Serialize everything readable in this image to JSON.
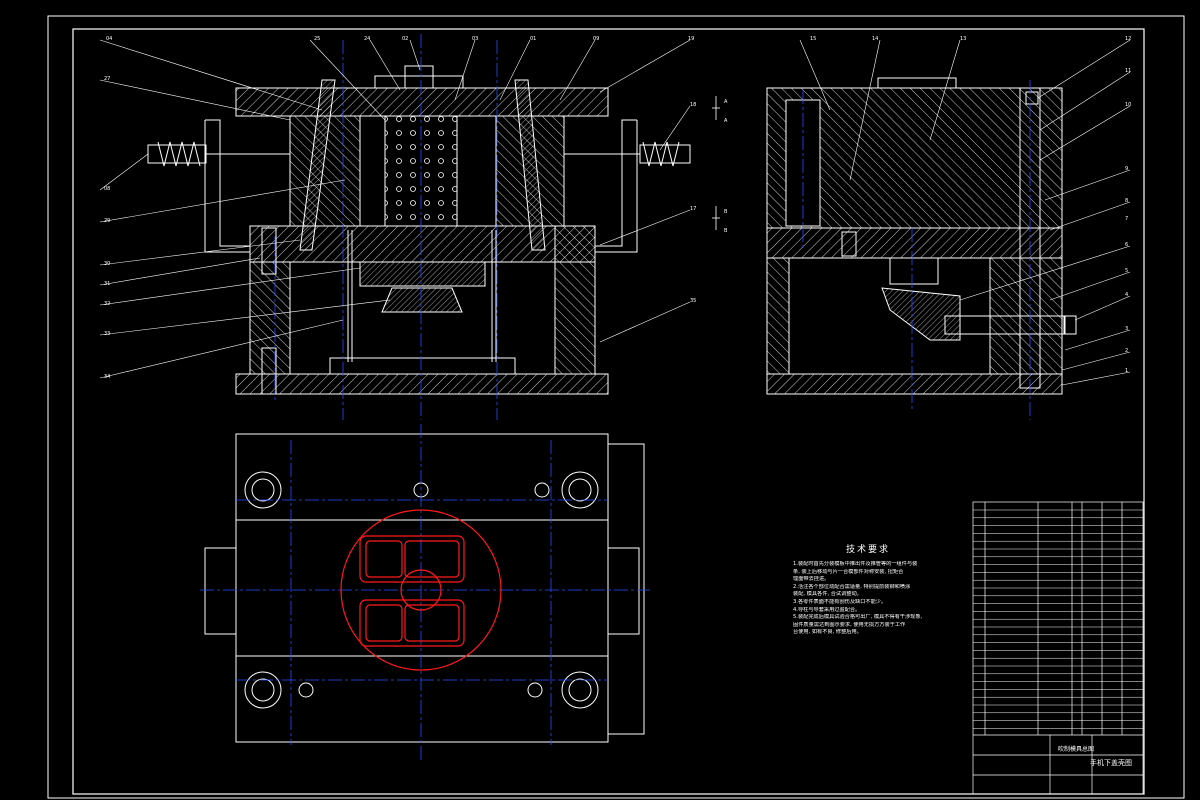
{
  "drawing": {
    "background": "#000000",
    "line_color": "#ffffff",
    "hatch_color": "#ffffff",
    "centerline_color": "#2a4dff",
    "part_color": "#ff1a1a",
    "dim_color": "#00c8ff",
    "callouts_front": [
      "04",
      "27",
      "25",
      "24",
      "02",
      "03",
      "01",
      "09",
      "19",
      "08",
      "29",
      "30",
      "31",
      "32",
      "33",
      "34",
      "18",
      "17",
      "35"
    ],
    "callouts_side": [
      "15",
      "14",
      "13",
      "12",
      "11",
      "10",
      "9",
      "8",
      "7",
      "6",
      "5",
      "4",
      "3",
      "2",
      "1"
    ],
    "section_marks": [
      "A",
      "A",
      "B",
      "B"
    ]
  },
  "tech_requirements": {
    "title": "技术要求",
    "lines": [
      "1.装配时首先分装模板中推出件及推管等的一组件与装",
      "  条, 装上后移动与片一合模部件对称安装, 扭矩合",
      "  理面带去挂进。",
      "2.活注各个部位动配合需适量, 特别提前装铆和喷涂",
      "  装配, 模具各件, 合试调整动。",
      "3.各零件表面不能有刮伤及缺口不能少。",
      "4.导柱与导套采用过盈配合。",
      "5.装配完成后模具试验合格可出厂, 模具不得有干涉现象,",
      "  固件质量需达到图示要求, 使用无损方方装于工作",
      "  台使用, 如有不良, 修整后用。"
    ]
  },
  "title_block": {
    "drawing_name": "吹制模具总图",
    "title": "手机下盖壳图"
  }
}
